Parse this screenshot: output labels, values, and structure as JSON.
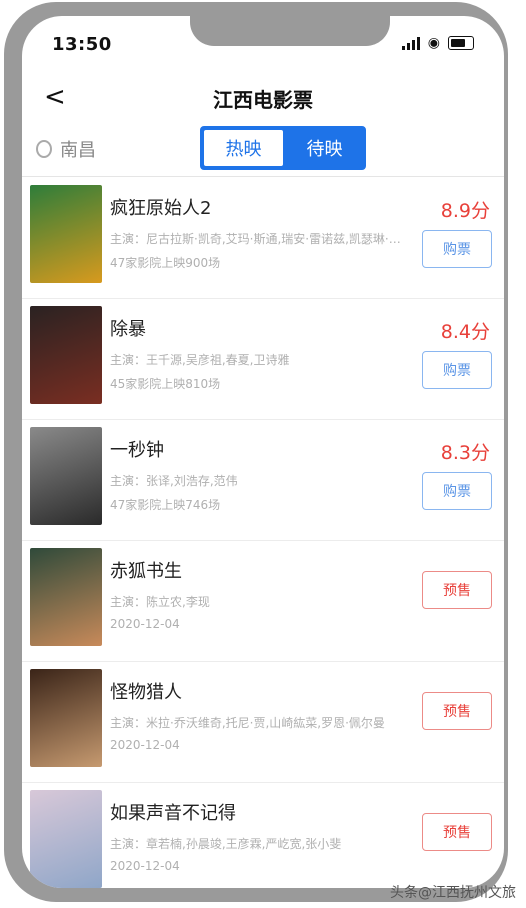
{
  "status_bar": {
    "time": "13:50"
  },
  "header": {
    "title": "江西电影票",
    "back_label": "<"
  },
  "location": {
    "city": "南昌"
  },
  "tabs": [
    {
      "label": "热映",
      "active": true
    },
    {
      "label": "待映",
      "active": false
    }
  ],
  "movies": [
    {
      "name": "疯狂原始人2",
      "score": "8.9分",
      "cast": "主演：尼古拉斯·凯奇,艾玛·斯通,瑞安·雷诺兹,凯瑟琳·基纳",
      "sub": "47家影院上映900场",
      "action": "购票",
      "poster_colors": [
        "#2e7d3a",
        "#d89a1e"
      ]
    },
    {
      "name": "除暴",
      "score": "8.4分",
      "cast": "主演：王千源,吴彦祖,春夏,卫诗雅",
      "sub": "45家影院上映810场",
      "action": "购票",
      "poster_colors": [
        "#2a2222",
        "#7a2e22"
      ]
    },
    {
      "name": "一秒钟",
      "score": "8.3分",
      "cast": "主演：张译,刘浩存,范伟",
      "sub": "47家影院上映746场",
      "action": "购票",
      "poster_colors": [
        "#8a8a8a",
        "#2a2a2a"
      ]
    },
    {
      "name": "赤狐书生",
      "score": "",
      "cast": "主演：陈立农,李现",
      "sub": "2020-12-04",
      "action": "预售",
      "poster_colors": [
        "#2f4a3a",
        "#c88a5a"
      ]
    },
    {
      "name": "怪物猎人",
      "score": "",
      "cast": "主演：米拉·乔沃维奇,托尼·贾,山崎紘菜,罗恩·佩尔曼",
      "sub": "2020-12-04",
      "action": "预售",
      "poster_colors": [
        "#3a2418",
        "#c69a70"
      ]
    },
    {
      "name": "如果声音不记得",
      "score": "",
      "cast": "主演：章若楠,孙晨竣,王彦霖,严屹宽,张小斐",
      "sub": "2020-12-04",
      "action": "预售",
      "poster_colors": [
        "#d8c8d8",
        "#8fa6c8"
      ]
    }
  ],
  "watermark": "头条@江西抚州文旅"
}
